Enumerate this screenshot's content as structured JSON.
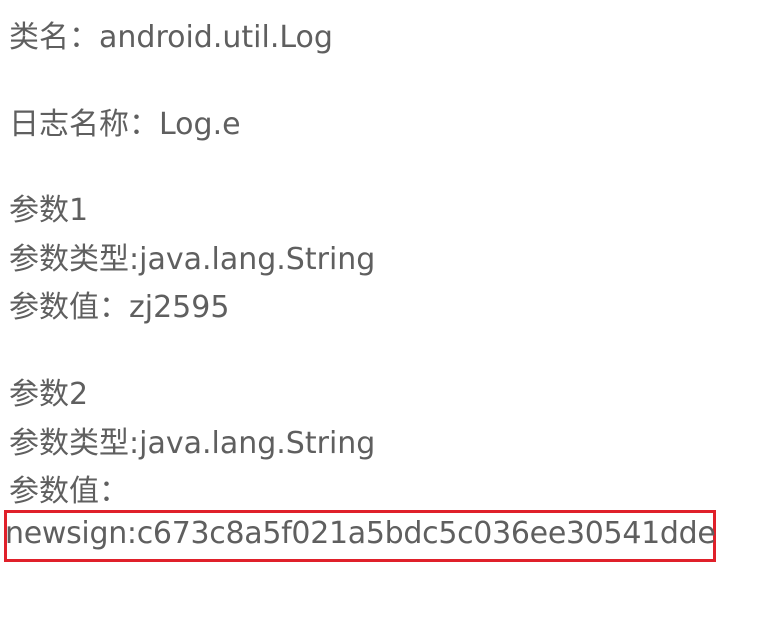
{
  "class_line": "类名：android.util.Log",
  "log_name_line": "日志名称：Log.e",
  "param1": {
    "title": "参数1",
    "type_line": "参数类型:java.lang.String",
    "value_line": "参数值：zj2595"
  },
  "param2": {
    "title": "参数2",
    "type_line": "参数类型:java.lang.String",
    "value_label": "参数值：",
    "value": "newsign:c673c8a5f021a5bdc5c036ee30541dde"
  },
  "colors": {
    "text": "#5f5f5f",
    "highlight_border": "#e0202a",
    "background": "#ffffff"
  }
}
